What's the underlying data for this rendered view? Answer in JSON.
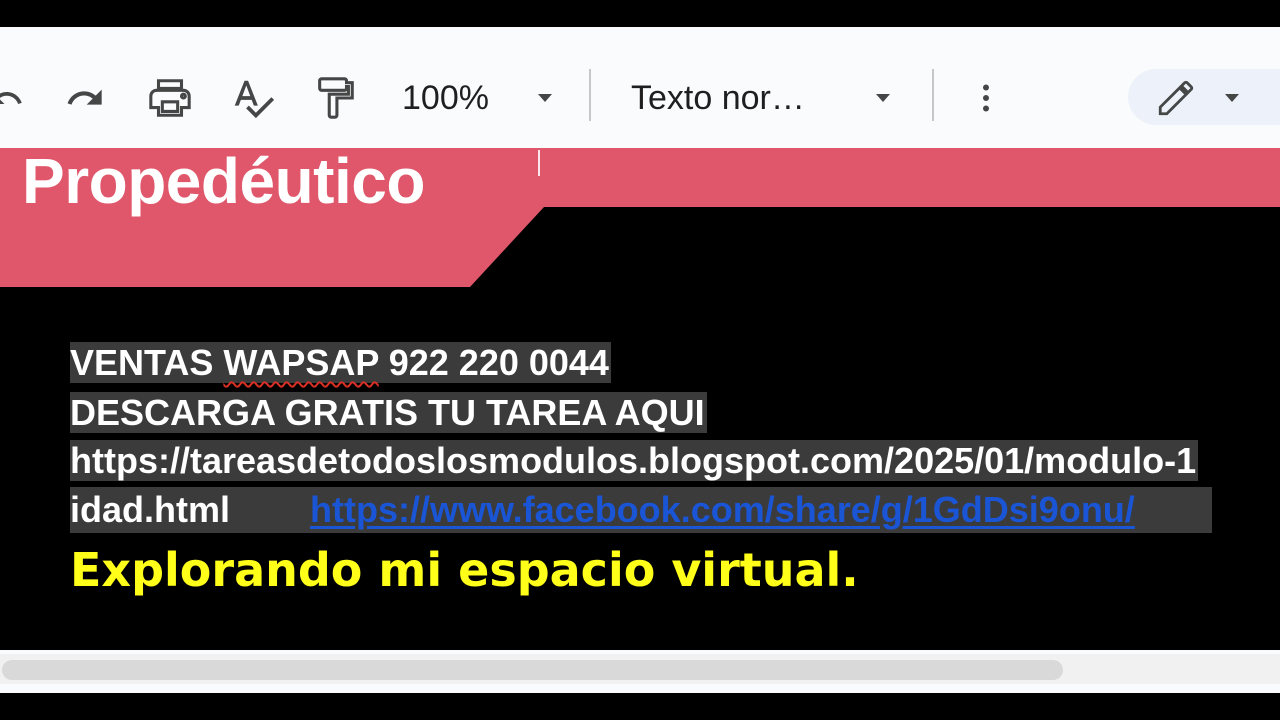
{
  "toolbar": {
    "zoom_value": "100%",
    "paragraph_style": "Texto nor…",
    "icons": [
      "undo-icon",
      "redo-icon",
      "print-icon",
      "spellcheck-icon",
      "paint-format-icon",
      "chevron-down-icon",
      "more-vert-icon",
      "pencil-edit-icon"
    ]
  },
  "document": {
    "banner_title": "Propedéutico",
    "lines": {
      "ventas_a": "VENTAS ",
      "ventas_b": "WAPSAP",
      "ventas_c": " 922 220 0044",
      "descarga": "DESCARGA GRATIS TU TAREA AQUI",
      "url_line1": "https://tareasdetodoslosmodulos.blogspot.com/2025/01/modulo-1",
      "url_line2": "idad.html",
      "facebook_link": "https://www.facebook.com/share/g/1GdDsi9onu/"
    },
    "yellow_text": "Explorando mi espacio virtual."
  },
  "colors": {
    "banner": "#e0566a",
    "yellow_text": "#ffff19",
    "link": "#1a55d6",
    "toolbar_bg": "#f9fbfd",
    "highlight": "#3b3b3b"
  }
}
